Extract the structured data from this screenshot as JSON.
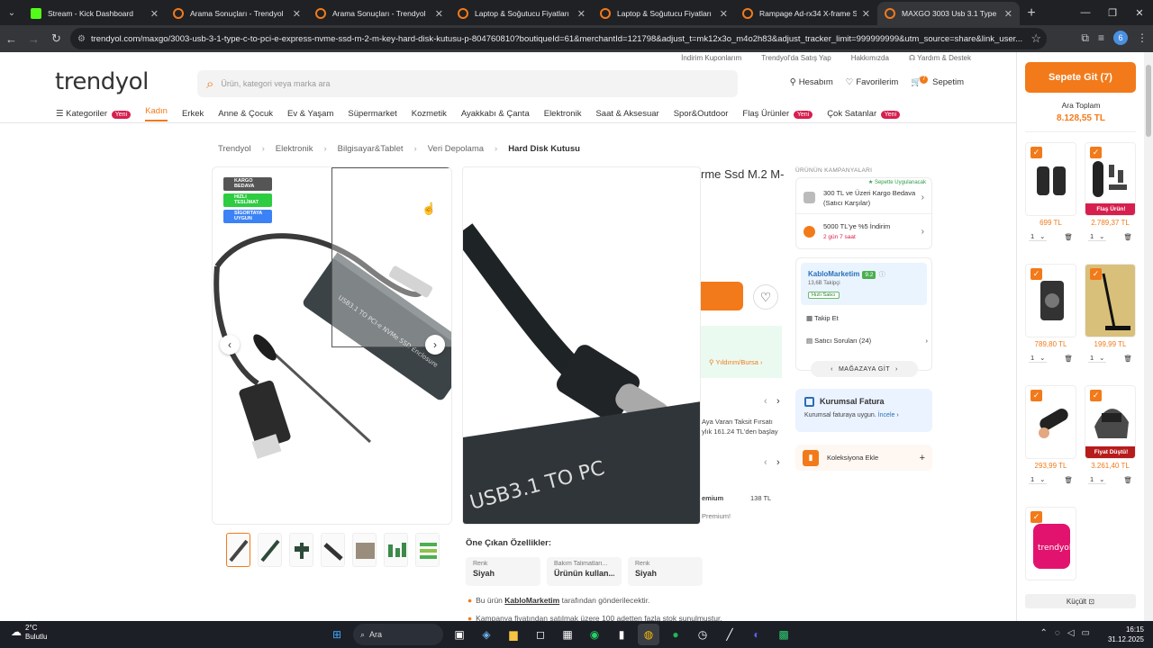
{
  "browser": {
    "tabs": [
      {
        "title": "Stream - Kick Dashboard",
        "color": "#53fc18"
      },
      {
        "title": "Arama Sonuçları - Trendyol",
        "color": "#f27a1a"
      },
      {
        "title": "Arama Sonuçları - Trendyol",
        "color": "#f27a1a"
      },
      {
        "title": "Laptop & Soğutucu Fiyatları | L",
        "color": "#f27a1a"
      },
      {
        "title": "Laptop & Soğutucu Fiyatları | L",
        "color": "#f27a1a"
      },
      {
        "title": "Rampage Ad-rx34 X-frame Siy",
        "color": "#f27a1a"
      },
      {
        "title": "MAXGO 3003 Usb 3.1 Type C T",
        "color": "#f27a1a"
      }
    ],
    "url": "trendyol.com/maxgo/3003-usb-3-1-type-c-to-pci-e-express-nvme-ssd-m-2-m-key-hard-disk-kutusu-p-804760810?boutiqueId=61&merchantId=121798&adjust_t=mk12x3o_m4o2h83&adjust_tracker_limit=999999999&utm_source=share&link_user...",
    "profile_initial": "6"
  },
  "header": {
    "top_links": [
      "İndirim Kuponlarım",
      "Trendyol'da Satış Yap",
      "Hakkımızda",
      "Yardım & Destek"
    ],
    "logo": "trendyol",
    "search_placeholder": "Ürün, kategori veya marka ara",
    "account": "Hesabım",
    "favorites": "Favorilerim",
    "cart": "Sepetim",
    "cart_count": "7"
  },
  "categories": {
    "kategoriler": "Kategoriler",
    "yeni": "Yeni",
    "items": [
      "Kadın",
      "Erkek",
      "Anne & Çocuk",
      "Ev & Yaşam",
      "Süpermarket",
      "Kozmetik",
      "Ayakkabı & Çanta",
      "Elektronik",
      "Saat & Aksesuar",
      "Spor&Outdoor"
    ],
    "flas": "Flaş Ürünler",
    "cok_satanlar": "Çok Satanlar"
  },
  "breadcrumb": [
    "Trendyol",
    "Elektronik",
    "Bilgisayar&Tablet",
    "Veri Depolama",
    "Hard Disk Kutusu"
  ],
  "product": {
    "badges": [
      {
        "text": "KARGO BEDAVA",
        "color": "#555555"
      },
      {
        "text": "HIZLI TESLİMAT",
        "color": "#2ecc40"
      },
      {
        "text": "SİGORTAYA UYGUN",
        "color": "#3b82f6"
      }
    ],
    "device_text": "USB3.1 TO PCI-e NVMe SSD Enclosure",
    "zoom_text": "USB3.1 TO PC",
    "title_fragment": "rme Ssd M.2 M-",
    "location": "Yıldırım/Bursa",
    "installment_1": "Aya Varan Taksit Fırsatı",
    "installment_2": "ylık 161.24 TL'den başlay",
    "premium_label": "emium",
    "premium_value": "138 TL",
    "premium_2": "Premium!",
    "features_title": "Öne Çıkan Özellikler:",
    "features": [
      {
        "key": "Renk",
        "value": "Siyah"
      },
      {
        "key": "Bakım Talimatları...",
        "value": "Ürünün kullan..."
      },
      {
        "key": "Renk",
        "value": "Siyah"
      }
    ],
    "seller_line_pre": "Bu ürün",
    "seller_line_name": "KabloMarketim",
    "seller_line_post": "tarafından gönderilecektir.",
    "seller_line_2": "Kampanya fiyatından satılmak üzere 100 adetten fazla stok sunulmuştur."
  },
  "campaigns": {
    "title": "ÜRÜNÜN KAMPANYALARI",
    "sepet_tag": "Sepette Uygulanacak",
    "items": [
      {
        "text": "300 TL ve Üzeri Kargo Bedava (Satıcı Karşılar)",
        "sub": ""
      },
      {
        "text": "5000 TL'ye %5 İndirim",
        "sub": "2 gün 7 saat"
      }
    ]
  },
  "seller": {
    "name": "KabloMarketim",
    "score": "9.2",
    "followers": "13,6B Takipçi",
    "hizli": "Hızlı Satıcı",
    "follow": "Takip Et",
    "questions": "Satıcı Soruları (24)",
    "store": "MAĞAZAYA GİT"
  },
  "kurumsal": {
    "title": "Kurumsal Fatura",
    "desc": "Kurumsal faturaya uygun.",
    "link": "İncele"
  },
  "collection": "Koleksiyona Ekle",
  "cart_panel": {
    "go_cart": "Sepete Git (7)",
    "subtotal_label": "Ara Toplam",
    "subtotal": "8.128,55 TL",
    "items": [
      {
        "price": "699 TL",
        "qty": "1",
        "ribbon": ""
      },
      {
        "price": "2.789,37 TL",
        "qty": "1",
        "ribbon": "Flaş Ürün!"
      },
      {
        "price": "789,80 TL",
        "qty": "1",
        "ribbon": ""
      },
      {
        "price": "199,99 TL",
        "qty": "1",
        "ribbon": ""
      },
      {
        "price": "293,99 TL",
        "qty": "1",
        "ribbon": ""
      },
      {
        "price": "3.261,40 TL",
        "qty": "1",
        "ribbon": "Fiyat Düştü!"
      },
      {
        "price": "",
        "qty": "",
        "ribbon": ""
      }
    ],
    "collapse": "Küçült",
    "gift_logo": "trendyol"
  },
  "taskbar": {
    "temp": "2°C",
    "weather": "Bulutlu",
    "search": "Ara",
    "time": "16:15",
    "date": "31.12.2025"
  }
}
